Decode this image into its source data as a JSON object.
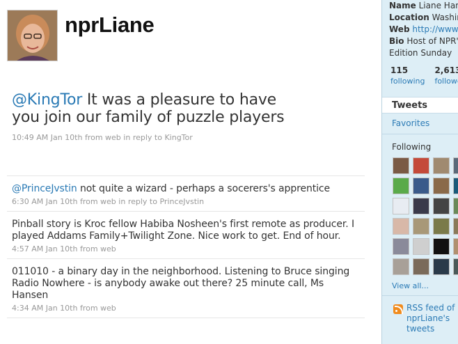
{
  "header": {
    "screen_name": "nprLiane",
    "avatar_icon": "person-avatar"
  },
  "featured_tweet": {
    "mention": "@KingTor",
    "text": " It was a pleasure to have you join our family of puzzle players",
    "meta": {
      "time": "10:49 AM Jan 10th",
      "from": " from ",
      "source": "web",
      "reply_prefix": " in reply to ",
      "reply_to": "KingTor"
    }
  },
  "tweets": [
    {
      "mention": "@PrinceJvstin",
      "text": " not quite a wizard - perhaps a socerers's apprentice",
      "time": "6:30 AM Jan 10th",
      "from": " from ",
      "source": "web",
      "reply_prefix": " in reply to ",
      "reply_to": "PrinceJvstin"
    },
    {
      "mention": "",
      "text": "Pinball story is Kroc fellow Habiba Nosheen's first remote as producer. I played Addams Family+Twilight Zone. Nice work to get. End of hour.",
      "time": "4:57 AM Jan 10th",
      "from": " from ",
      "source": "web",
      "reply_prefix": "",
      "reply_to": ""
    },
    {
      "mention": "",
      "text": "011010 - a binary day in the neighborhood. Listening to Bruce singing Radio Nowhere - is anybody awake out there? 25 minute call, Ms Hansen",
      "time": "4:34 AM Jan 10th",
      "from": " from ",
      "source": "web",
      "reply_prefix": "",
      "reply_to": ""
    }
  ],
  "sidebar": {
    "profile": {
      "name_label": "Name",
      "name_value": "Liane Hansen",
      "location_label": "Location",
      "location_value": "Washington, DC",
      "web_label": "Web",
      "web_value": "http://www.npr.org",
      "bio_label": "Bio",
      "bio_line1": "Host of NPR's",
      "bio_line2": "Edition Sunday"
    },
    "stats": {
      "following_count": "115",
      "following_label": "following",
      "followers_count": "2,613",
      "followers_label": "followers"
    },
    "nav": {
      "tweets_label": "Tweets",
      "favorites_label": "Favorites"
    },
    "following_title": "Following",
    "view_all_label": "View all...",
    "rss": {
      "icon": "rss-icon",
      "line1": "RSS feed of nprLiane's",
      "line2": "tweets"
    },
    "thumb_colors": [
      "#7a5a45",
      "#c44a3a",
      "#a08a70",
      "#5a6a7a",
      "#5aaa4a",
      "#3a5a8a",
      "#8a6a4a",
      "#1a5a7a",
      "#e8ecf2",
      "#3a3a4a",
      "#444444",
      "#6a8a5a",
      "#d8b8a8",
      "#a89878",
      "#7a7a4a",
      "#8a7a5a",
      "#8a8a9a",
      "#cfcfcf",
      "#111111",
      "#b09070",
      "#a8a098",
      "#7a6a5a",
      "#2a3a4a",
      "#4a5a5a"
    ]
  }
}
